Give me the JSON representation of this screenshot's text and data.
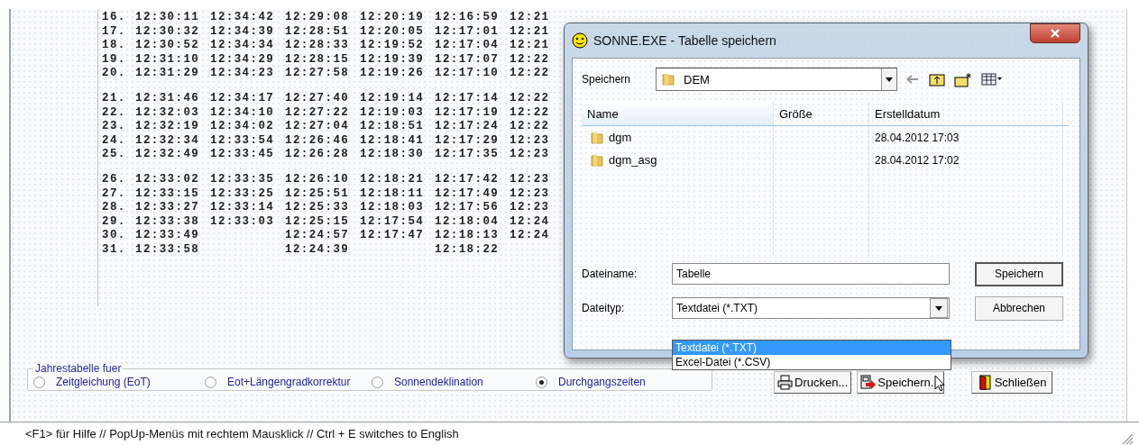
{
  "table": {
    "row_groups": [
      {
        "rows": [
          {
            "day": "16.",
            "column_1": "12:30:11",
            "column_2": "12:34:42",
            "column_3": "12:29:08",
            "column_4": "12:20:19",
            "column_5": "12:16:59",
            "column_6": "12:21"
          },
          {
            "day": "17.",
            "column_1": "12:30:32",
            "column_2": "12:34:39",
            "column_3": "12:28:51",
            "column_4": "12:20:05",
            "column_5": "12:17:01",
            "column_6": "12:21"
          },
          {
            "day": "18.",
            "column_1": "12:30:52",
            "column_2": "12:34:34",
            "column_3": "12:28:33",
            "column_4": "12:19:52",
            "column_5": "12:17:04",
            "column_6": "12:21"
          },
          {
            "day": "19.",
            "column_1": "12:31:10",
            "column_2": "12:34:29",
            "column_3": "12:28:15",
            "column_4": "12:19:39",
            "column_5": "12:17:07",
            "column_6": "12:22"
          },
          {
            "day": "20.",
            "column_1": "12:31:29",
            "column_2": "12:34:23",
            "column_3": "12:27:58",
            "column_4": "12:19:26",
            "column_5": "12:17:10",
            "column_6": "12:22"
          }
        ]
      },
      {
        "rows": [
          {
            "day": "21.",
            "column_1": "12:31:46",
            "column_2": "12:34:17",
            "column_3": "12:27:40",
            "column_4": "12:19:14",
            "column_5": "12:17:14",
            "column_6": "12:22"
          },
          {
            "day": "22.",
            "column_1": "12:32:03",
            "column_2": "12:34:10",
            "column_3": "12:27:22",
            "column_4": "12:19:03",
            "column_5": "12:17:19",
            "column_6": "12:22"
          },
          {
            "day": "23.",
            "column_1": "12:32:19",
            "column_2": "12:34:02",
            "column_3": "12:27:04",
            "column_4": "12:18:51",
            "column_5": "12:17:24",
            "column_6": "12:22"
          },
          {
            "day": "24.",
            "column_1": "12:32:34",
            "column_2": "12:33:54",
            "column_3": "12:26:46",
            "column_4": "12:18:41",
            "column_5": "12:17:29",
            "column_6": "12:23"
          },
          {
            "day": "25.",
            "column_1": "12:32:49",
            "column_2": "12:33:45",
            "column_3": "12:26:28",
            "column_4": "12:18:30",
            "column_5": "12:17:35",
            "column_6": "12:23"
          }
        ]
      },
      {
        "rows": [
          {
            "day": "26.",
            "column_1": "12:33:02",
            "column_2": "12:33:35",
            "column_3": "12:26:10",
            "column_4": "12:18:21",
            "column_5": "12:17:42",
            "column_6": "12:23"
          },
          {
            "day": "27.",
            "column_1": "12:33:15",
            "column_2": "12:33:25",
            "column_3": "12:25:51",
            "column_4": "12:18:11",
            "column_5": "12:17:49",
            "column_6": "12:23"
          },
          {
            "day": "28.",
            "column_1": "12:33:27",
            "column_2": "12:33:14",
            "column_3": "12:25:33",
            "column_4": "12:18:03",
            "column_5": "12:17:56",
            "column_6": "12:23"
          },
          {
            "day": "29.",
            "column_1": "12:33:38",
            "column_2": "12:33:03",
            "column_3": "12:25:15",
            "column_4": "12:17:54",
            "column_5": "12:18:04",
            "column_6": "12:24"
          },
          {
            "day": "30.",
            "column_1": "12:33:49",
            "column_3": "12:24:57",
            "column_4": "12:17:47",
            "column_5": "12:18:13",
            "column_6": "12:24"
          },
          {
            "day": "31.",
            "column_1": "12:33:58",
            "column_3": "12:24:39",
            "column_5": "12:18:22"
          }
        ]
      }
    ]
  },
  "table_options": {
    "legend": "Jahrestabelle fuer",
    "radios": [
      {
        "label": "Zeitgleichung (EoT)",
        "selected": false
      },
      {
        "label": "Eot+Längengradkorrektur",
        "selected": false
      },
      {
        "label": "Sonnendeklination",
        "selected": false
      },
      {
        "label": "Durchgangszeiten",
        "selected": true
      }
    ]
  },
  "buttons": [
    {
      "kind": "print",
      "label": "Drucken..."
    },
    {
      "kind": "save",
      "label": "Speichern..."
    },
    {
      "kind": "close",
      "label": "Schließen"
    }
  ],
  "status_bar": "<F1>  für Hilfe // PopUp-Menüs mit rechtem Mausklick // Ctrl + E  switches to English",
  "dialog": {
    "title": "SONNE.EXE - Tabelle speichern",
    "location_label": "Speichern",
    "location": "DEM",
    "columns": [
      "Name",
      "Größe",
      "Erstelldatum"
    ],
    "files": [
      {
        "name": "dgm",
        "created": "28.04.2012 17:03"
      },
      {
        "name": "dgm_asg",
        "created": "28.04.2012 17:02"
      }
    ],
    "filename_label": "Dateiname:",
    "filename": "Tabelle",
    "filetype_label": "Dateityp:",
    "filetype": "Textdatei (*.TXT)",
    "filetype_options": [
      {
        "label": "Textdatei (*.TXT)",
        "selected": true
      },
      {
        "label": "Excel-Datei (*.CSV)",
        "selected": false
      }
    ],
    "buttons": [
      "Speichern",
      "Abbrechen"
    ]
  }
}
